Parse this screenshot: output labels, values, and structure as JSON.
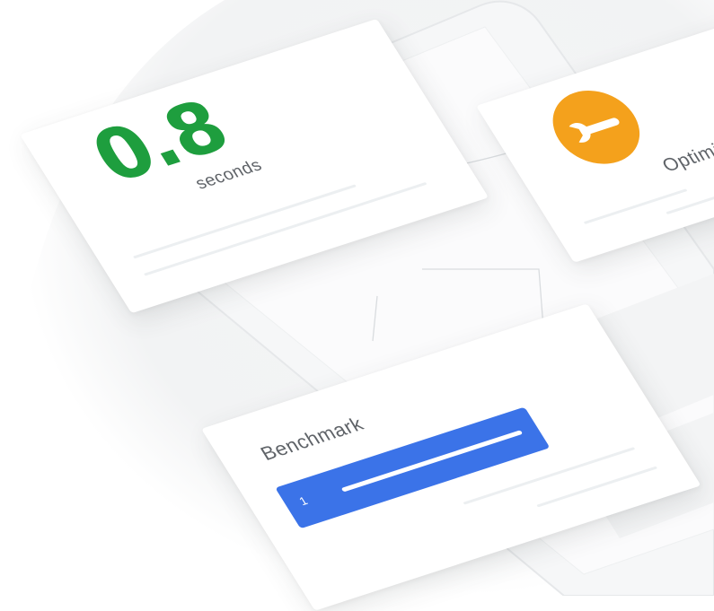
{
  "speed_card": {
    "value": "0.8",
    "unit": "seconds"
  },
  "optimize_card": {
    "label": "Optimize",
    "icon": "wrench-icon",
    "accent": "#f4a11c"
  },
  "benchmark_card": {
    "title": "Benchmark",
    "rank": "1",
    "accent": "#3b73e8"
  },
  "colors": {
    "speed_value": "#1e9e3e",
    "label_gray": "#5f6368"
  }
}
